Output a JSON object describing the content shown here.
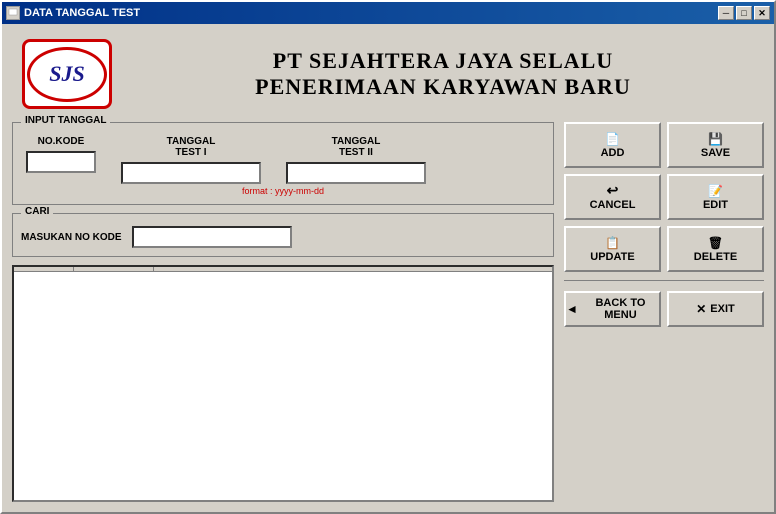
{
  "window": {
    "title": "DATA TANGGAL TEST"
  },
  "header": {
    "company_name": "PT SEJAHTERA JAYA SELALU",
    "company_subtitle": "PENERIMAAN KARYAWAN BARU",
    "logo_text": "SJS"
  },
  "form": {
    "group_label": "INPUT TANGGAL",
    "no_kode_label": "NO.KODE",
    "tanggal_test1_label": "TANGGAL\nTEST I",
    "tanggal_test2_label": "TANGGAL\nTEST II",
    "format_hint": "format : yyyy-mm-dd",
    "no_kode_placeholder": "",
    "tanggal1_placeholder": "",
    "tanggal2_placeholder": ""
  },
  "search": {
    "group_label": "CARI",
    "label": "MASUKAN NO KODE",
    "placeholder": ""
  },
  "table": {
    "col1": "",
    "col2": ""
  },
  "buttons": {
    "add": "ADD",
    "save": "SAVE",
    "cancel": "CANCEL",
    "edit": "EDIT",
    "update": "UPDATE",
    "delete": "DELETE",
    "back_to_menu": "BACK TO MENU",
    "exit": "EXIT"
  },
  "title_buttons": {
    "minimize": "─",
    "maximize": "□",
    "close": "✕"
  }
}
